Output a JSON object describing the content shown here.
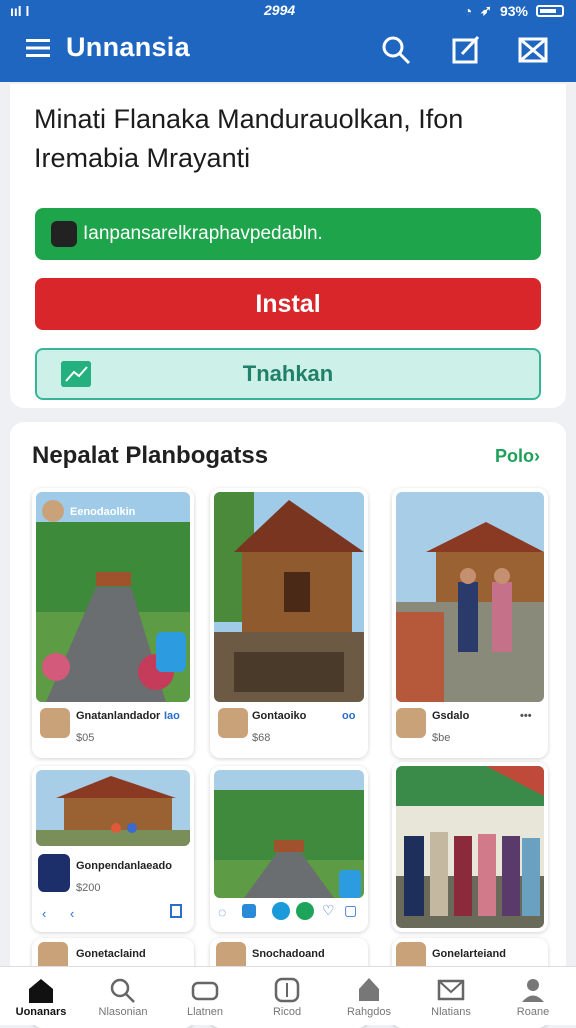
{
  "status": {
    "signal": "ııl l",
    "time": "2994",
    "battery_text": "93%"
  },
  "appbar": {
    "title": "Unnansia"
  },
  "hero": {
    "headline": "Minati Flanaka Mandurauolkan, Ifon Iremabia Mrayanti",
    "green_button": "Ianpansarelkraphavpedabln.",
    "red_button": "Instal",
    "teal_button": "Tnahkan"
  },
  "section": {
    "title": "Nepalat Planbogatss",
    "link": "Polo›"
  },
  "posts": [
    {
      "overlay": "Eenodaolkin",
      "name": "Gnatanlandador",
      "meta": "Iao",
      "sub": "$05"
    },
    {
      "name": "Gontaoiko",
      "meta": "oo",
      "sub": "$68"
    },
    {
      "name": "Gsdalo",
      "meta": "•••",
      "sub": "$be"
    },
    {
      "name": "Gonpendanlaeado",
      "sub": "$200"
    },
    {
      "name": "Gonetaclaind"
    },
    {
      "name": "Snochadoand"
    },
    {
      "name": "Gonelarteiand"
    }
  ],
  "tabs": [
    {
      "label": "Uonanars",
      "icon": "home-icon"
    },
    {
      "label": "Nlasonian",
      "icon": "search-icon"
    },
    {
      "label": "Llatnen",
      "icon": "wallet-icon"
    },
    {
      "label": "Ricod",
      "icon": "compass-icon"
    },
    {
      "label": "Rahgdos",
      "icon": "temple-icon"
    },
    {
      "label": "Nlatians",
      "icon": "mail-icon"
    },
    {
      "label": "Roane",
      "icon": "profile-icon"
    }
  ],
  "colors": {
    "brand": "#1f66c1",
    "green": "#1ea44a",
    "red": "#d9262a",
    "teal": "#39b596"
  }
}
